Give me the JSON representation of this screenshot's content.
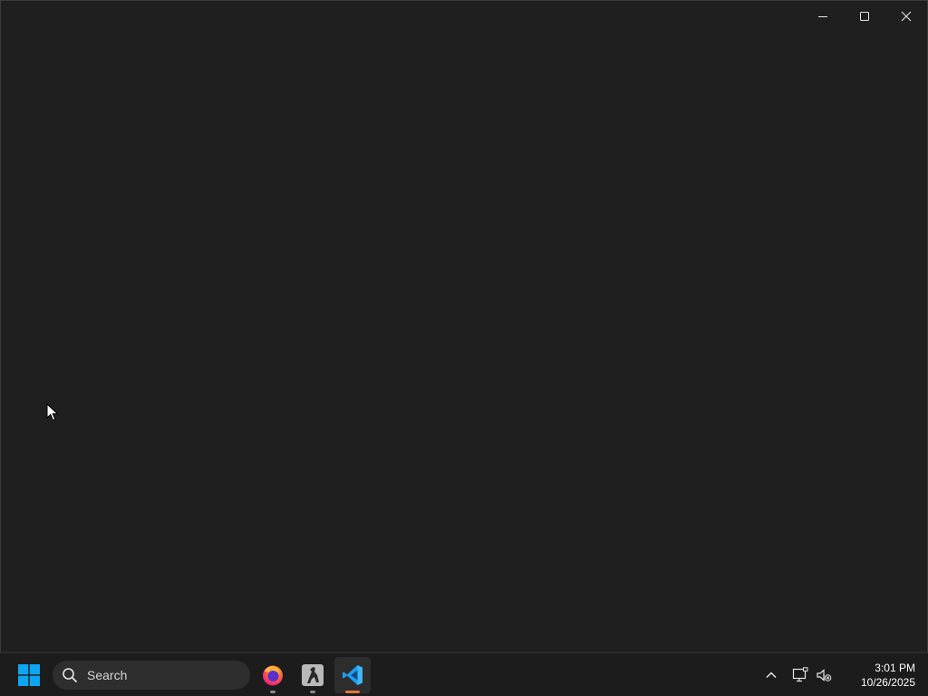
{
  "window": {
    "controls": {
      "minimize_icon": "minimize-icon",
      "maximize_icon": "maximize-icon",
      "close_icon": "close-icon"
    }
  },
  "taskbar": {
    "search": {
      "placeholder": "Search"
    },
    "apps": [
      {
        "name": "firefox",
        "icon": "firefox-icon",
        "state": "open"
      },
      {
        "name": "counter-strike",
        "icon": "counter-strike-icon",
        "state": "open"
      },
      {
        "name": "vscode",
        "icon": "vscode-icon",
        "state": "focused"
      }
    ],
    "tray": {
      "clock": {
        "time": "3:01 PM",
        "date": "10/26/2025"
      }
    }
  },
  "colors": {
    "background": "#1f1f1f",
    "taskbar": "#1c1c1c",
    "accent_focused": "#e8753a",
    "windows_blue": "#0ea5f0"
  }
}
